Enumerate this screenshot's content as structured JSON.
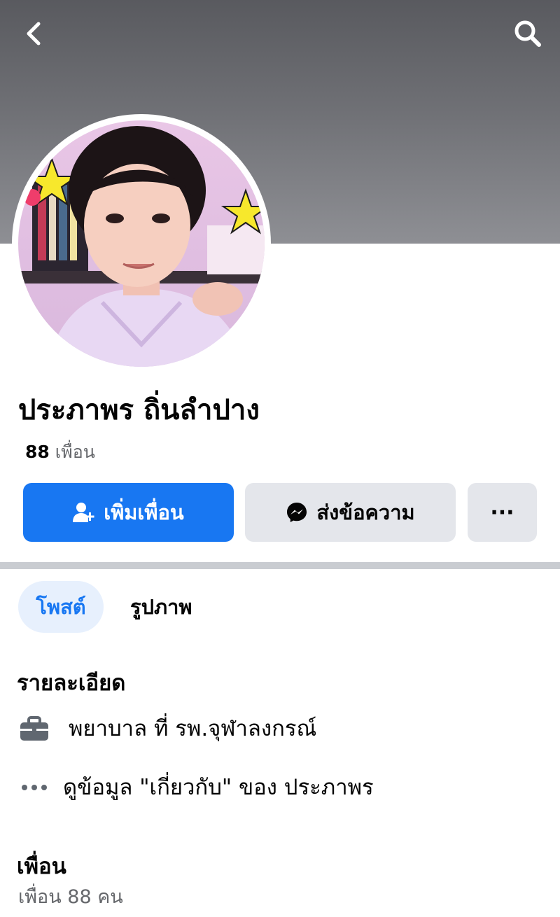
{
  "header": {
    "back_icon": "chevron-left-icon",
    "search_icon": "search-icon",
    "cover_color": "#6f7075"
  },
  "profile": {
    "name": "ประภาพร ถิ่นลำปาง",
    "friends_count": "88",
    "friends_label": "เพื่อน"
  },
  "actions": {
    "add_friend_label": "เพิ่มเพื่อน",
    "message_label": "ส่งข้อความ",
    "more_label": "···"
  },
  "tabs": [
    {
      "label": "โพสต์",
      "active": true
    },
    {
      "label": "รูปภาพ",
      "active": false
    }
  ],
  "details": {
    "title": "รายละเอียด",
    "work": "พยาบาล ที่ รพ.จุฬาลงกรณ์",
    "about_link": "ดูข้อมูล \"เกี่ยวกับ\" ของ ประภาพร"
  },
  "friends_section": {
    "title": "เพื่อน",
    "count_text": "เพื่อน 88 คน"
  },
  "colors": {
    "accent": "#1877f2",
    "secondary_button": "#e4e6eb",
    "active_tab_bg": "#e7f0fd"
  }
}
